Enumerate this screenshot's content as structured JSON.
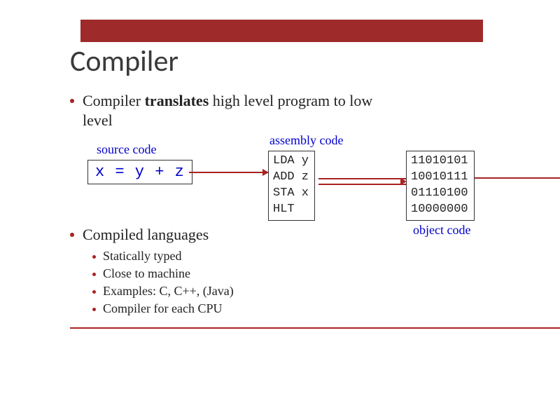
{
  "title": "Compiler",
  "bullets": {
    "b1_pre": "Compiler ",
    "b1_bold": "translates",
    "b1_post": " high level program to low level",
    "b2": "Compiled languages",
    "sub": [
      "Statically typed",
      "Close to machine",
      "Examples: C, C++, (Java)",
      "Compiler for each CPU"
    ]
  },
  "diagram": {
    "source_label": "source code",
    "assembly_label": "assembly code",
    "object_label": "object code",
    "source_code": "x = y + z",
    "assembly_code": "LDA y\nADD z\nSTA x\nHLT",
    "object_code": "11010101\n10010111\n01110100\n10000000"
  }
}
